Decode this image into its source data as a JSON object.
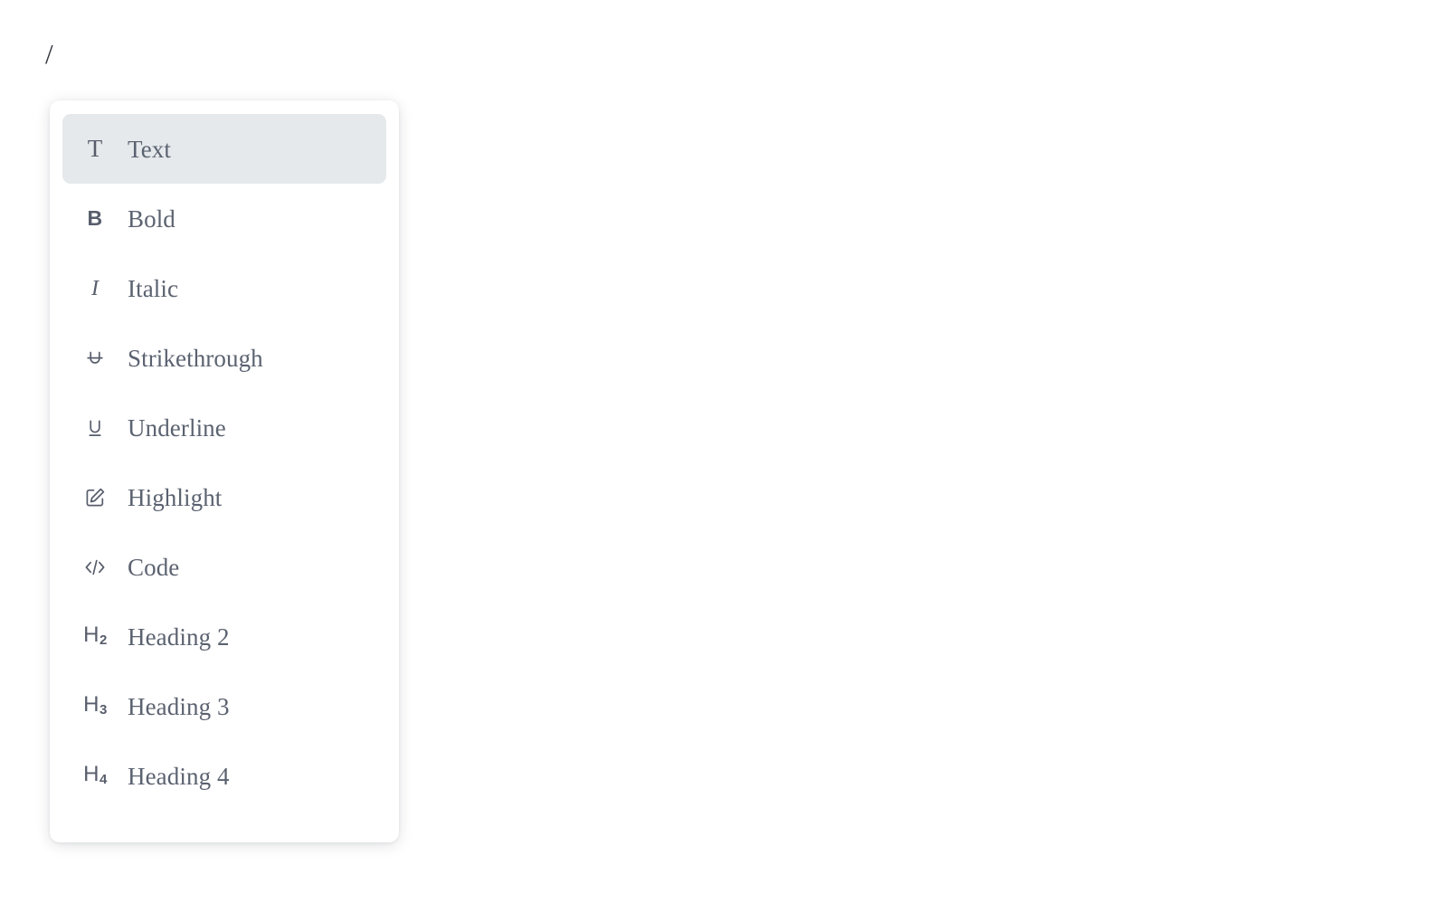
{
  "editor": {
    "typed_text": "/"
  },
  "colors": {
    "page_background": "#ffffff",
    "panel_background": "#ffffff",
    "active_item_background": "#e5e9ec",
    "label_text": "#5b6270",
    "icon": "#575d6b",
    "typed_text": "#2f343d"
  },
  "slash_menu": {
    "name": "slash-command-menu",
    "active_index": 0,
    "items": [
      {
        "label": "Text",
        "icon": "text-t-icon"
      },
      {
        "label": "Bold",
        "icon": "bold-b-icon"
      },
      {
        "label": "Italic",
        "icon": "italic-i-icon"
      },
      {
        "label": "Strikethrough",
        "icon": "strikethrough-u-icon"
      },
      {
        "label": "Underline",
        "icon": "underline-u-icon"
      },
      {
        "label": "Highlight",
        "icon": "highlight-pencil-square-icon"
      },
      {
        "label": "Code",
        "icon": "code-angle-brackets-icon"
      },
      {
        "label": "Heading 2",
        "icon": "heading-2-icon"
      },
      {
        "label": "Heading 3",
        "icon": "heading-3-icon"
      },
      {
        "label": "Heading 4",
        "icon": "heading-4-icon"
      }
    ]
  }
}
